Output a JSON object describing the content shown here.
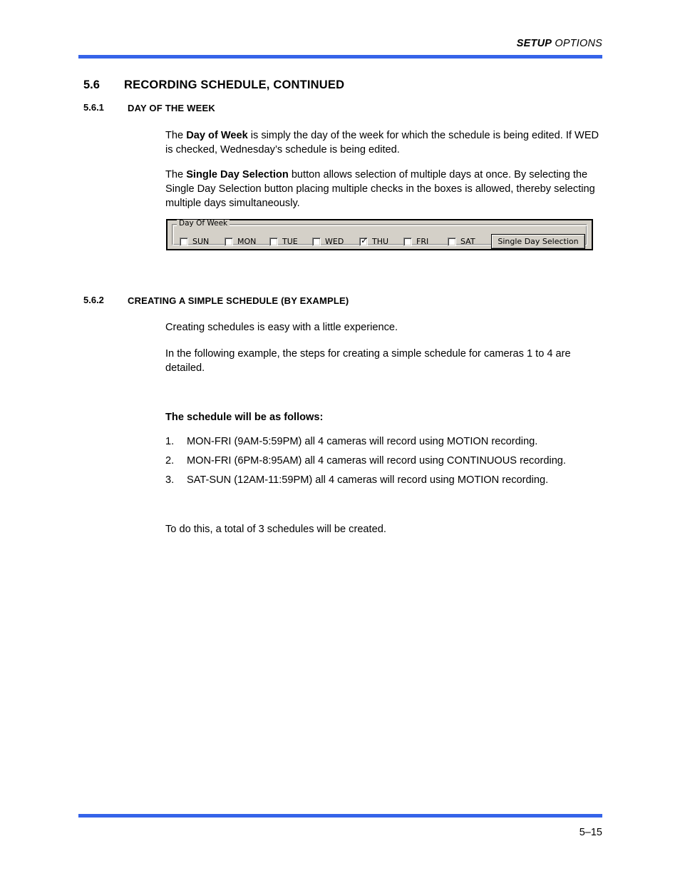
{
  "header": {
    "strong": "SETUP",
    "rest": " OPTIONS",
    "rule_color": "#3563e9"
  },
  "footer": {
    "page_number": "5–15"
  },
  "headings": {
    "section": {
      "number": "5.6",
      "title": "RECORDING SCHEDULE, CONTINUED"
    },
    "sub1": {
      "number": "5.6.1",
      "title": "DAY OF THE WEEK"
    },
    "sub2": {
      "number": "5.6.2",
      "title": "CREATING A SIMPLE SCHEDULE (BY EXAMPLE)"
    }
  },
  "body": {
    "day_of_week_para": {
      "pre": "The ",
      "bold": "Day of Week",
      "post": " is simply the day of the week for which the schedule is being edited. If WED is checked, Wednesday’s schedule is being edited."
    },
    "single_day_para": {
      "pre": "The ",
      "bold": "Single Day Selection",
      "post": " button allows selection of multiple days at once. By selecting the Single Day Selection button placing multiple checks in the boxes is allowed, thereby selecting multiple days simultaneously."
    },
    "easy_para": "Creating schedules is easy with a little experience.",
    "example_para": "In the following example, the steps for creating a simple schedule for cameras 1 to 4 are detailed.",
    "schedule_lead": "The schedule will be as follows:",
    "schedule_items": [
      {
        "marker": "1.",
        "text": "MON-FRI (9AM-5:59PM) all 4 cameras will record using MOTION recording."
      },
      {
        "marker": "2.",
        "text": "MON-FRI (6PM-8:95AM) all 4 cameras will record using CONTINUOUS recording."
      },
      {
        "marker": "3.",
        "text": "SAT-SUN (12AM-11:59PM) all 4 cameras will record using MOTION recording."
      }
    ],
    "total_para": "To do this, a total of 3 schedules will be created."
  },
  "day_of_week_widget": {
    "legend": "Day Of Week",
    "panel_color": "#d4d0c8",
    "checkboxes": [
      {
        "label": "SUN",
        "checked": false,
        "mark": ""
      },
      {
        "label": "MON",
        "checked": false,
        "mark": ""
      },
      {
        "label": "TUE",
        "checked": false,
        "mark": ""
      },
      {
        "label": "WED",
        "checked": false,
        "mark": ""
      },
      {
        "label": "THU",
        "checked": true,
        "mark": "✓"
      },
      {
        "label": "FRI",
        "checked": false,
        "mark": ""
      },
      {
        "label": "SAT",
        "checked": false,
        "mark": ""
      }
    ],
    "button_label": "Single Day Selection"
  }
}
